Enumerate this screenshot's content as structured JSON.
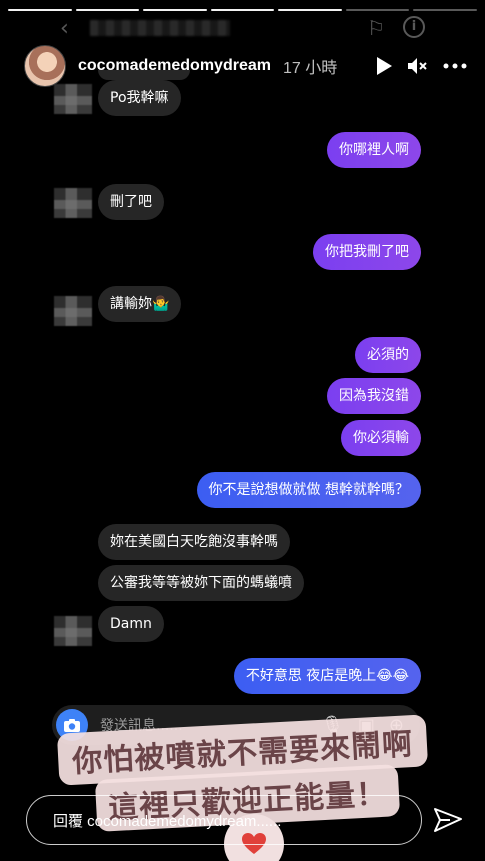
{
  "story": {
    "username": "cocomademedomydream",
    "time": "17 小時",
    "segments": [
      true,
      true,
      true,
      true,
      true,
      false,
      false
    ]
  },
  "chat": {
    "messages": [
      {
        "side": "in",
        "text": "Po我幹嘛"
      },
      {
        "side": "out",
        "text": "你哪裡人啊"
      },
      {
        "side": "in",
        "text": "刪了吧"
      },
      {
        "side": "out",
        "text": "你把我刪了吧"
      },
      {
        "side": "in",
        "text": "講輸妳🤷‍♂️"
      },
      {
        "side": "out",
        "text": "必須的"
      },
      {
        "side": "out",
        "text": "因為我沒錯"
      },
      {
        "side": "out",
        "text": "你必須輸"
      },
      {
        "side": "out",
        "text": "你不是說想做就做 想幹就幹嗎？"
      },
      {
        "side": "in",
        "text": "妳在美國白天吃飽沒事幹嗎"
      },
      {
        "side": "in",
        "text": "公審我等等被妳下面的螞蟻噴"
      },
      {
        "side": "in",
        "text": "Damn"
      },
      {
        "side": "out",
        "text": "不好意思 夜店是晚上😂😂"
      }
    ],
    "compose_placeholder": "發送訊息......"
  },
  "sticker": {
    "line1": "你怕被噴就不需要來鬧啊",
    "line2": "這裡只歡迎正能量！"
  },
  "reply": {
    "placeholder": "回覆 cocomademedomydream......"
  }
}
